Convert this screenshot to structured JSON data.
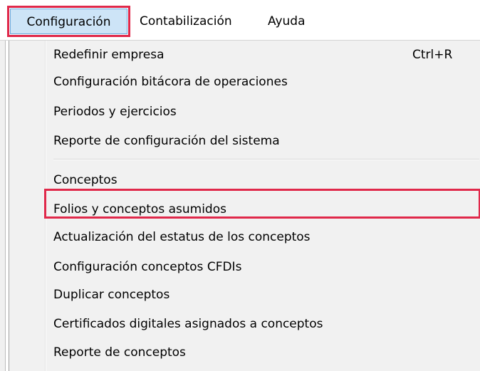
{
  "menubar": {
    "items": [
      {
        "label": "Configuración"
      },
      {
        "label": "Contabilización"
      },
      {
        "label": "Ayuda"
      }
    ]
  },
  "dropdown": {
    "items": [
      {
        "label": "Redefinir empresa",
        "shortcut": "Ctrl+R"
      },
      {
        "label": "Configuración bitácora de operaciones"
      },
      {
        "label": "Periodos y ejercicios"
      },
      {
        "label": "Reporte de configuración del sistema"
      },
      {
        "label": "Conceptos"
      },
      {
        "label": "Folios y conceptos asumidos"
      },
      {
        "label": "Actualización del estatus de los conceptos"
      },
      {
        "label": "Configuración conceptos CFDIs"
      },
      {
        "label": "Duplicar conceptos"
      },
      {
        "label": "Certificados digitales asignados a conceptos"
      },
      {
        "label": "Reporte de conceptos"
      }
    ]
  },
  "colors": {
    "highlight": "#e0284a",
    "active_menu_bg": "#cde4f7",
    "menu_bg": "#f1f1f1"
  }
}
